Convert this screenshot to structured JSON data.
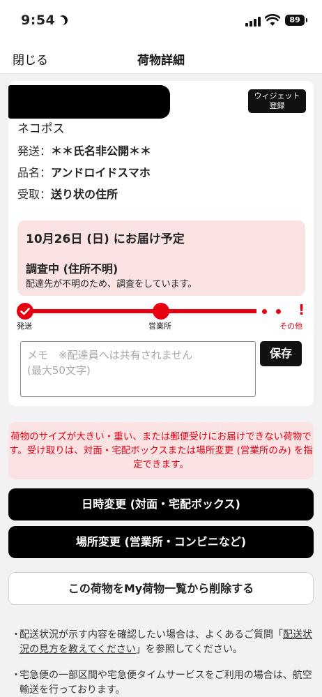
{
  "status_bar": {
    "time": "9:54",
    "battery": "89",
    "icons": [
      "moon-icon",
      "signal-icon",
      "wifi-icon",
      "battery-icon"
    ]
  },
  "nav": {
    "close_label": "閉じる",
    "title": "荷物詳細"
  },
  "package": {
    "widget_button": "ウィジェット\n登録",
    "service": "ネコポス",
    "sender_label": "発送：",
    "sender_value": "＊＊氏名非公開＊＊",
    "item_label": "品名：",
    "item_value": "アンドロイドスマホ",
    "receive_label": "受取：",
    "receive_value": "送り状の住所"
  },
  "delivery_alert": {
    "date_text": "10月26日 (日) にお届け予定",
    "status": "調査中 (住所不明)",
    "detail": "配達先が不明のため、調査をしています。"
  },
  "progress": {
    "labels": [
      "発送",
      "営業所",
      "その他"
    ]
  },
  "memo": {
    "placeholder": "メモ　※配達員へは共有されません\n(最大50文字)",
    "save_label": "保存"
  },
  "notice": "荷物のサイズが大きい・重い、または郵便受けにお届けできない荷物です。受け取りは、対面・宅配ボックスまたは場所変更 (営業所のみ) を指定できます。",
  "buttons": {
    "change_datetime": "日時変更 (対面・宅配ボックス)",
    "change_place": "場所変更 (営業所・コンビニなど)",
    "remove": "この荷物をMy荷物一覧から削除する"
  },
  "footer": {
    "bullet_1_pre": "配送状況が示す内容を確認したい場合は、よくあるご質問「",
    "bullet_1_link": "配送状況の見方を教えてください",
    "bullet_1_post": "」を参照してください。",
    "bullet_2": "宅急便の一部区間や宅急便タイムサービスをご利用の場合は、航空輸送を行っております。",
    "bullet_marker": "・"
  },
  "colors": {
    "accent": "#e60012",
    "alert_bg": "#fbe3e4",
    "button_bg": "#000000"
  }
}
